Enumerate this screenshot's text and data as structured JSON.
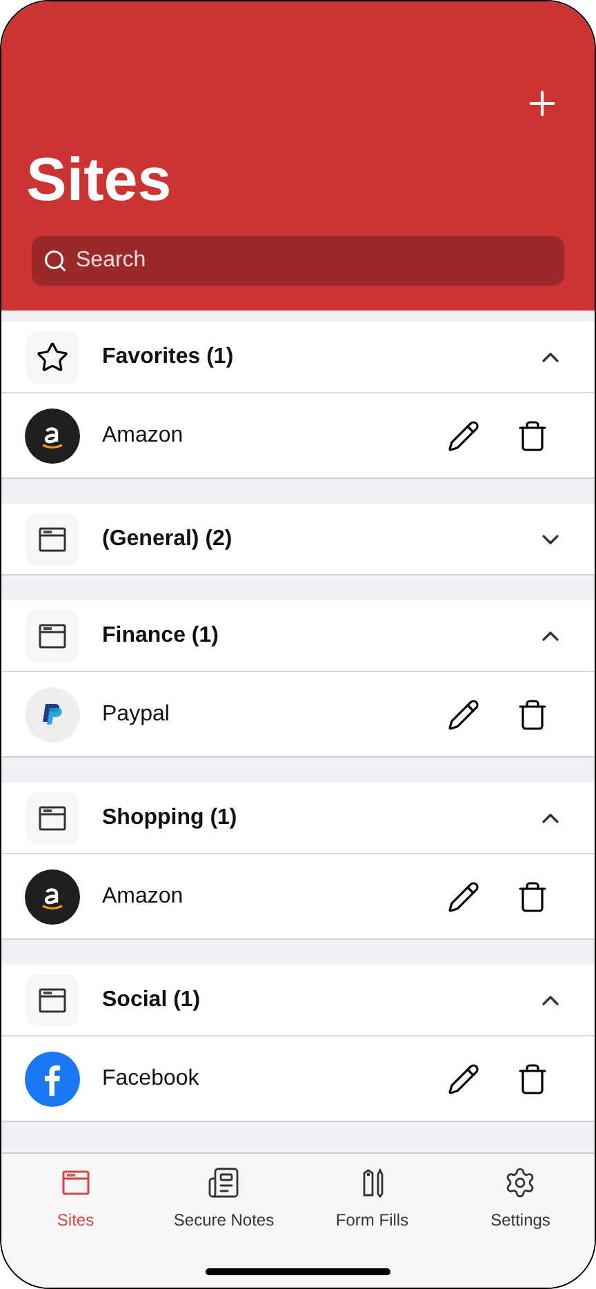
{
  "header": {
    "title": "Sites",
    "search": {
      "placeholder": "Search"
    }
  },
  "groups": [
    {
      "kind": "favorites",
      "label": "Favorites (1)",
      "expanded": true,
      "items": [
        {
          "kind": "amazon",
          "name": "Amazon"
        }
      ]
    },
    {
      "kind": "folder",
      "label": "(General) (2)",
      "expanded": false
    },
    {
      "kind": "folder",
      "label": "Finance (1)",
      "expanded": true,
      "items": [
        {
          "kind": "paypal",
          "name": "Paypal"
        }
      ]
    },
    {
      "kind": "folder",
      "label": "Shopping (1)",
      "expanded": true,
      "items": [
        {
          "kind": "amazon",
          "name": "Amazon"
        }
      ]
    },
    {
      "kind": "folder",
      "label": "Social (1)",
      "expanded": true,
      "items": [
        {
          "kind": "facebook",
          "name": "Facebook"
        }
      ]
    }
  ],
  "tabs": [
    {
      "kind": "sites",
      "label": "Sites",
      "selected": true
    },
    {
      "kind": "notes",
      "label": "Secure Notes",
      "selected": false
    },
    {
      "kind": "forms",
      "label": "Form Fills",
      "selected": false
    },
    {
      "kind": "settings",
      "label": "Settings",
      "selected": false
    }
  ]
}
